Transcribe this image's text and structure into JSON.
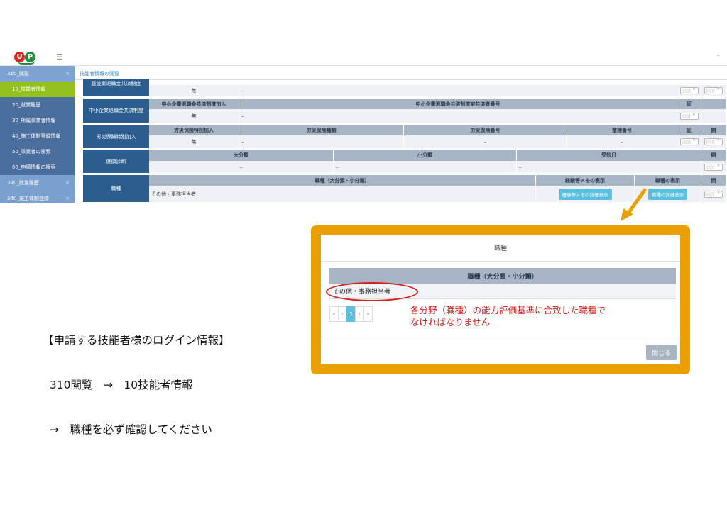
{
  "header": {
    "logo_u": "U",
    "logo_p": "P",
    "menu_icon": "hamburger-icon",
    "caret": "-"
  },
  "sidebar": {
    "group1": "310_閲覧",
    "items": [
      "10_技能者情報",
      "20_就業履歴",
      "30_所属事業者情報",
      "40_施工体制登録情報",
      "50_事業者の検索",
      "60_申請情報の検索"
    ],
    "group2": "320_就業履歴",
    "group3": "340_施工体制登録",
    "collapse_icon": "×",
    "colors": {
      "bg": "#4a6e9e",
      "active": "#95c11f",
      "group": "#7fa3d0"
    }
  },
  "breadcrumb": "技能者情報の閲覧",
  "table": {
    "row0": {
      "label": "建設業退職金共済制度",
      "value": "無",
      "dash": "–"
    },
    "row1": {
      "label": "中小企業退職金共済制度",
      "headers": [
        "中小企業退職金共済制度加入",
        "中小企業退職金共済制度被共済者番号",
        "証"
      ],
      "values": [
        "無",
        "–"
      ]
    },
    "row2": {
      "label": "労災保険特別加入",
      "headers": [
        "労災保険特別加入",
        "労災保険種類",
        "労災保険番号",
        "整理番号",
        "証",
        "開"
      ],
      "values": [
        "無",
        "–",
        "–",
        "–"
      ]
    },
    "row3": {
      "label": "健康診断",
      "headers": [
        "大分類",
        "小分類",
        "受診日",
        "開"
      ],
      "values": [
        "–",
        "–",
        "–"
      ]
    },
    "row4": {
      "label": "職種",
      "headers": [
        "職種（大分類・小分類）",
        "経験等メモの表示",
        "職種の表示",
        "開"
      ],
      "value": "その他・事務担当者",
      "btn_memo": "経験等メモの詳細表示",
      "btn_job": "職種の詳細表示"
    }
  },
  "annotation": {
    "line1": "【申請する技能者様のログイン情報】",
    "line2": "  310閲覧　→　10技能者情報",
    "line3": "  →　職種を必ず確認してください"
  },
  "modal": {
    "title": "職種",
    "col_header": "職種（大分類・小分類）",
    "value": "その他・事務担当者",
    "pager": [
      "«",
      "‹",
      "1",
      "›",
      "»"
    ],
    "note": "各分野（職種）の能力評価基準に合致した職種で\nなければなりません",
    "close_label": "閉じる",
    "frame_color": "#e9a000",
    "note_color": "#d32020"
  }
}
